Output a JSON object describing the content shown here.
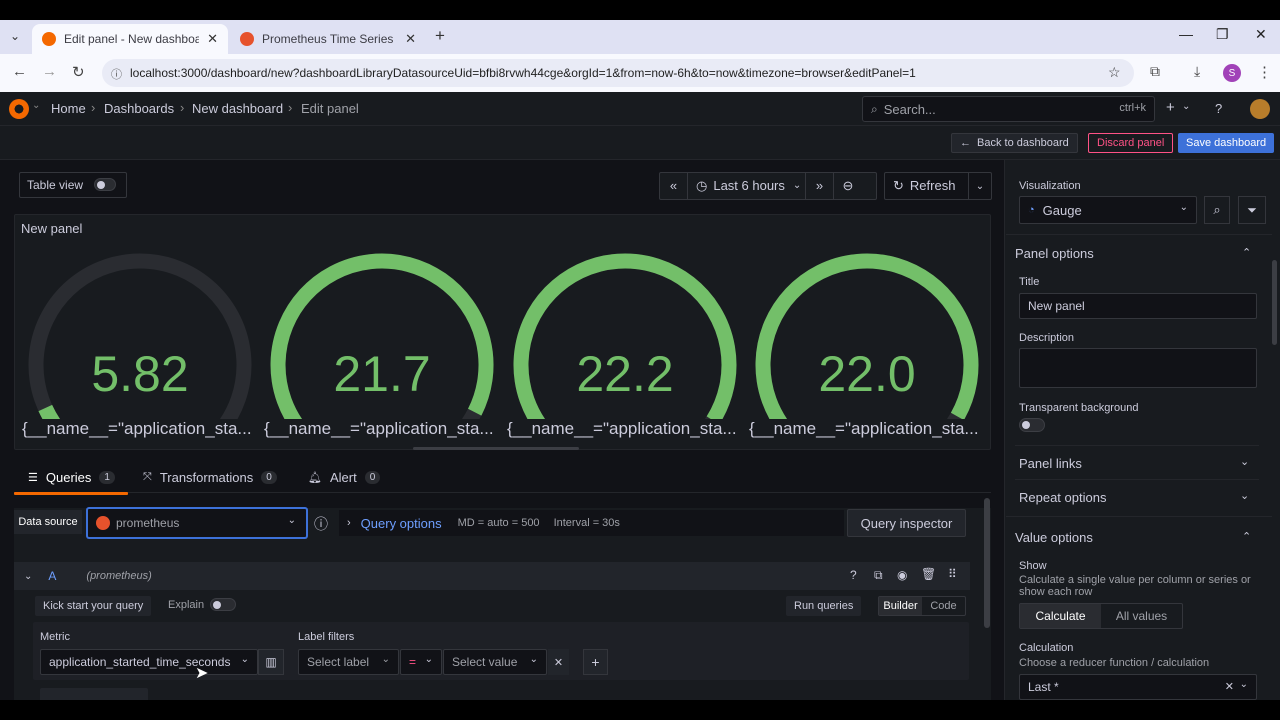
{
  "browser": {
    "tabs": [
      {
        "title": "Edit panel - New dashboard - D",
        "active": true
      },
      {
        "title": "Prometheus Time Series Collect",
        "active": false
      }
    ],
    "url": "localhost:3000/dashboard/new?dashboardLibraryDatasourceUid=bfbi8rvwh44cge&orgId=1&from=now-6h&to=now&timezone=browser&editPanel=1",
    "profile_initial": "S"
  },
  "breadcrumb": [
    "Home",
    "Dashboards",
    "New dashboard",
    "Edit panel"
  ],
  "search": {
    "placeholder": "Search...",
    "shortcut": "ctrl+k"
  },
  "toolbar": {
    "back_label": "Back to dashboard",
    "discard_label": "Discard panel",
    "save_label": "Save dashboard"
  },
  "controls": {
    "table_view_label": "Table view",
    "time_range": "Last 6 hours",
    "refresh_label": "Refresh"
  },
  "panel": {
    "title": "New panel",
    "gauges": [
      {
        "value": "5.82",
        "label": "{__name__=\"application_sta...",
        "fill": 0.06
      },
      {
        "value": "21.7",
        "label": "{__name__=\"application_sta...",
        "fill": 0.95
      },
      {
        "value": "22.2",
        "label": "{__name__=\"application_sta...",
        "fill": 0.97
      },
      {
        "value": "22.0",
        "label": "{__name__=\"application_sta...",
        "fill": 0.96
      }
    ]
  },
  "query_tabs": [
    {
      "label": "Queries",
      "count": "1"
    },
    {
      "label": "Transformations",
      "count": "0"
    },
    {
      "label": "Alert",
      "count": "0"
    }
  ],
  "query": {
    "datasource_label": "Data source",
    "datasource": "prometheus",
    "options_label": "Query options",
    "md": "MD = auto = 500",
    "interval": "Interval = 30s",
    "inspector_label": "Query inspector",
    "refid": "A",
    "ds_hint": "(prometheus)",
    "kickstart_label": "Kick start your query",
    "explain_label": "Explain",
    "run_label": "Run queries",
    "builder_label": "Builder",
    "code_label": "Code",
    "metric_label": "Metric",
    "metric_value": "application_started_time_seconds",
    "label_filters_label": "Label filters",
    "select_label": "Select label",
    "operator": "=",
    "select_value": "Select value"
  },
  "options_pane": {
    "viz_label": "Visualization",
    "viz_value": "Gauge",
    "panel_options": "Panel options",
    "title_label": "Title",
    "title_value": "New panel",
    "description_label": "Description",
    "transparent_label": "Transparent background",
    "panel_links": "Panel links",
    "repeat_options": "Repeat options",
    "value_options": "Value options",
    "show_label": "Show",
    "show_desc": "Calculate a single value per column or series or show each row",
    "calculate_label": "Calculate",
    "all_values_label": "All values",
    "calculation_label": "Calculation",
    "calculation_desc": "Choose a reducer function / calculation",
    "calculation_value": "Last *"
  },
  "colors": {
    "accent": "#3d71d9",
    "gauge": "#73bf69",
    "danger": "#ff5286"
  }
}
